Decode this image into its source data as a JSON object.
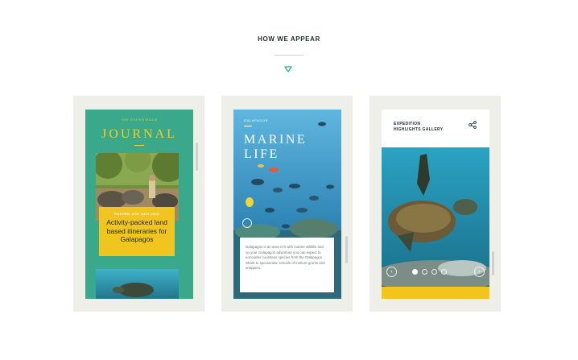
{
  "section": {
    "title": "HOW WE APPEAR"
  },
  "journal": {
    "eyebrow": "THE EXPERIENCE",
    "title": "JOURNAL",
    "date": "POSTED: 8TH JULY 2015",
    "headline": "Activity-packed land based itineraries for Galapagos"
  },
  "marine": {
    "eyebrow": "GALAPAGOS",
    "title": "MARINE LIFE",
    "body": "Galapagos is an area rich with marine wildlife and on your Galapagos adventure you can expect to encounter countless species from the Galapagos Shark to spectacular schools of inshore grunts and snappers."
  },
  "gallery": {
    "heading_line1": "EXPEDITION",
    "heading_line2": "HIGHLIGHTS GALLERY",
    "prev_symbol": "‹",
    "next_symbol": "›"
  },
  "icons": [
    "chevron-down-icon",
    "share-icon",
    "prev-arrow-icon",
    "next-arrow-icon"
  ],
  "colors": {
    "accent_green": "#3aa88a",
    "accent_yellow": "#f1c51f",
    "ocean_blue": "#3b97c4"
  }
}
